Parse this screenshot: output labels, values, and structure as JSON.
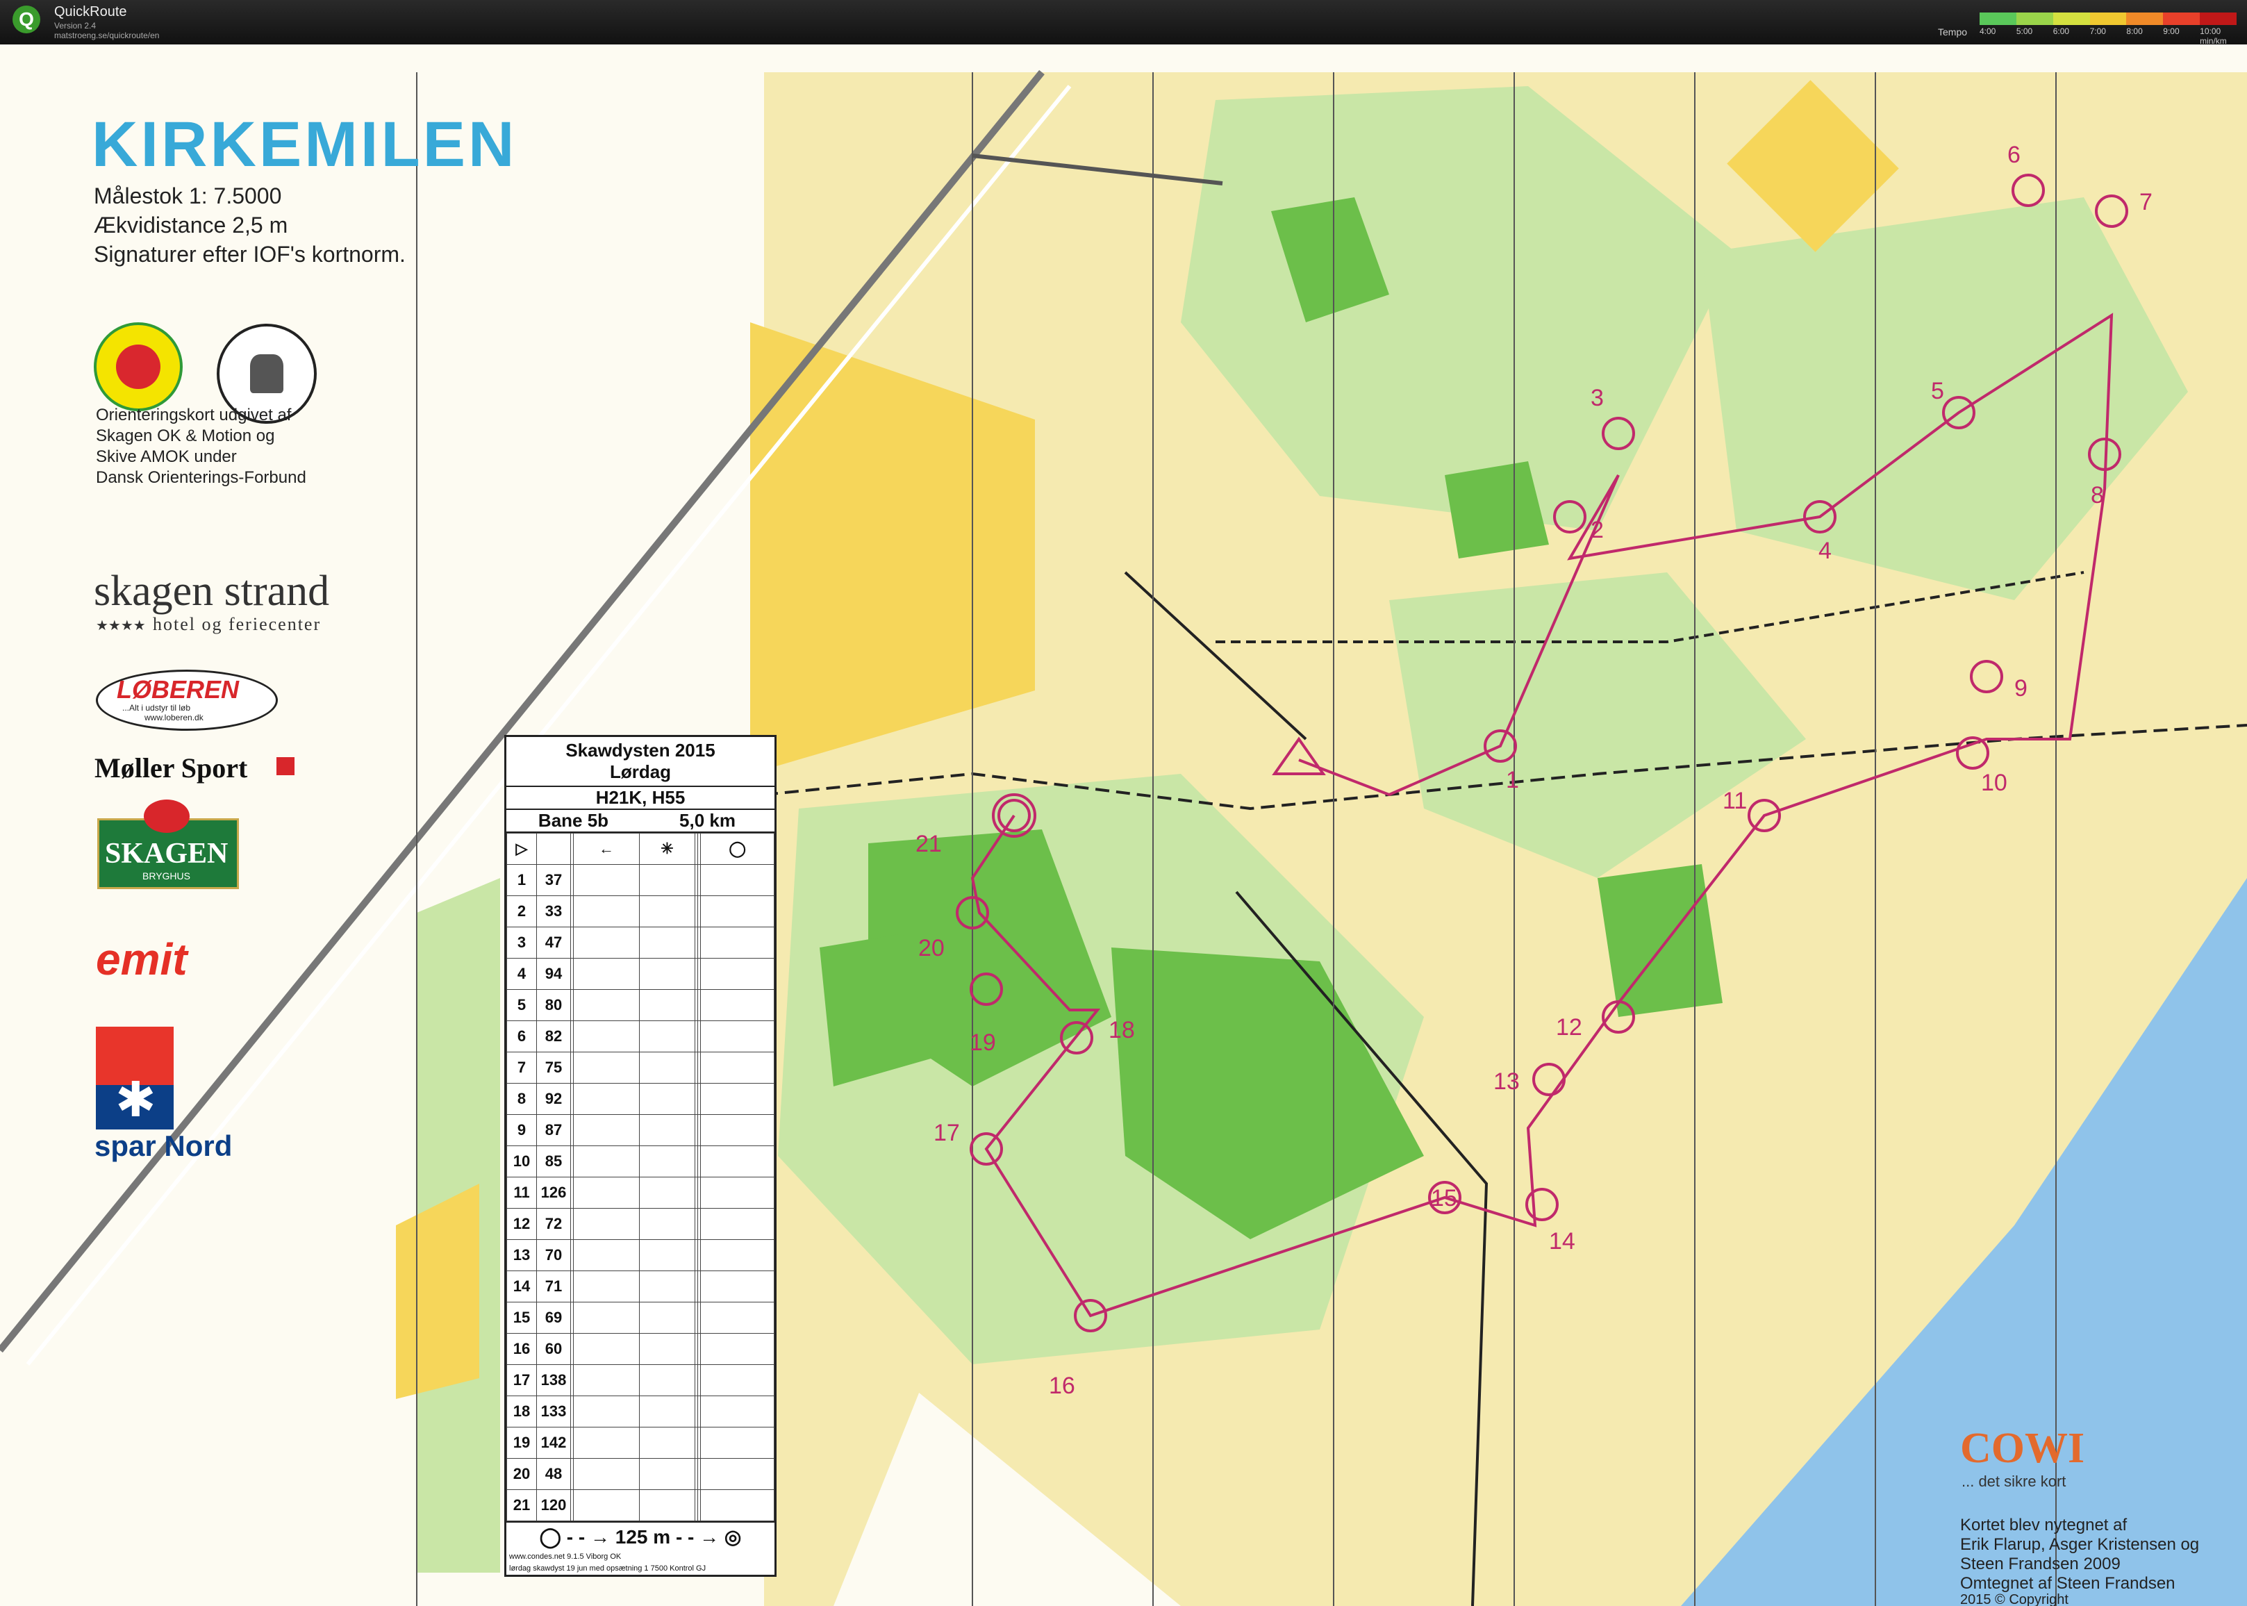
{
  "app": {
    "icon_letter": "Q",
    "title": "QuickRoute",
    "version": "Version 2.4",
    "url": "matstroeng.se/quickroute/en"
  },
  "tempo": {
    "label": "Tempo",
    "ticks": [
      "4:00",
      "5:00",
      "6:00",
      "7:00",
      "8:00",
      "9:00",
      "10:00 min/km"
    ],
    "colors": [
      "#5ac85a",
      "#9ad44a",
      "#d4e040",
      "#f0c830",
      "#f08a28",
      "#e8402a",
      "#c01818"
    ]
  },
  "map": {
    "title": "KIRKEMILEN",
    "scale": "Målestok 1: 7.5000",
    "equidistance": "Ækvidistance 2,5 m",
    "norm": "Signaturer efter IOF's kortnorm.",
    "publisher": [
      "Orienteringskort udgivet af",
      "Skagen OK & Motion og",
      "Skive AMOK under",
      "Dansk Orienterings-Forbund"
    ],
    "colors": {
      "forest_light": "#c9e6a6",
      "forest_green": "#6cbf4a",
      "open": "#f6d65a",
      "rough_open": "#f5eab0",
      "water": "#8fc3ea",
      "course": "#c0296b"
    }
  },
  "logos": {
    "skagen_ok": "SKAGEN OK & MOTION",
    "skive_amok": "SKIVE AMOK",
    "skagen_strand_name": "skagen strand",
    "skagen_strand_stars": "★★★★",
    "skagen_strand_sub": "hotel og feriecenter",
    "loberen_name": "LØBEREN",
    "loberen_tag": "...Alt i udstyr til løb",
    "loberen_url": "www.loberen.dk",
    "moller_sport": "Møller Sport",
    "skagen_bryghus_name": "SKAGEN",
    "skagen_bryghus_sub": "BRYGHUS",
    "emit": "emit",
    "spar_nord": "spar Nord"
  },
  "control_description": {
    "event": "Skawdysten 2015",
    "day": "Lørdag",
    "classes": "H21K, H55",
    "course": "Bane 5b",
    "length": "5,0 km",
    "controls": [
      {
        "n": "1",
        "code": "37"
      },
      {
        "n": "2",
        "code": "33"
      },
      {
        "n": "3",
        "code": "47"
      },
      {
        "n": "4",
        "code": "94"
      },
      {
        "n": "5",
        "code": "80"
      },
      {
        "n": "6",
        "code": "82"
      },
      {
        "n": "7",
        "code": "75"
      },
      {
        "n": "8",
        "code": "92"
      },
      {
        "n": "9",
        "code": "87"
      },
      {
        "n": "10",
        "code": "85"
      },
      {
        "n": "11",
        "code": "126"
      },
      {
        "n": "12",
        "code": "72"
      },
      {
        "n": "13",
        "code": "70"
      },
      {
        "n": "14",
        "code": "71"
      },
      {
        "n": "15",
        "code": "69"
      },
      {
        "n": "16",
        "code": "60"
      },
      {
        "n": "17",
        "code": "138"
      },
      {
        "n": "18",
        "code": "133"
      },
      {
        "n": "19",
        "code": "142"
      },
      {
        "n": "20",
        "code": "48"
      },
      {
        "n": "21",
        "code": "120"
      }
    ],
    "finish": "125 m",
    "credit_1": "www.condes.net 9.1.5 Viborg OK",
    "credit_2": "lørdag skawdyst 19 jun med opsætning 1 7500 Kontrol GJ"
  },
  "cowi": {
    "name": "COWI",
    "tagline": "... det sikre kort",
    "credits": [
      "Kortet blev nytegnet af",
      "Erik Flarup, Asger Kristensen og",
      "Steen Frandsen   2009",
      "Omtegnet af Steen Frandsen",
      "2015       © Copyright"
    ]
  },
  "control_labels": [
    "1",
    "2",
    "3",
    "4",
    "5",
    "6",
    "7",
    "8",
    "9",
    "10",
    "11",
    "12",
    "13",
    "14",
    "15",
    "16",
    "17",
    "18",
    "19",
    "20",
    "21"
  ]
}
